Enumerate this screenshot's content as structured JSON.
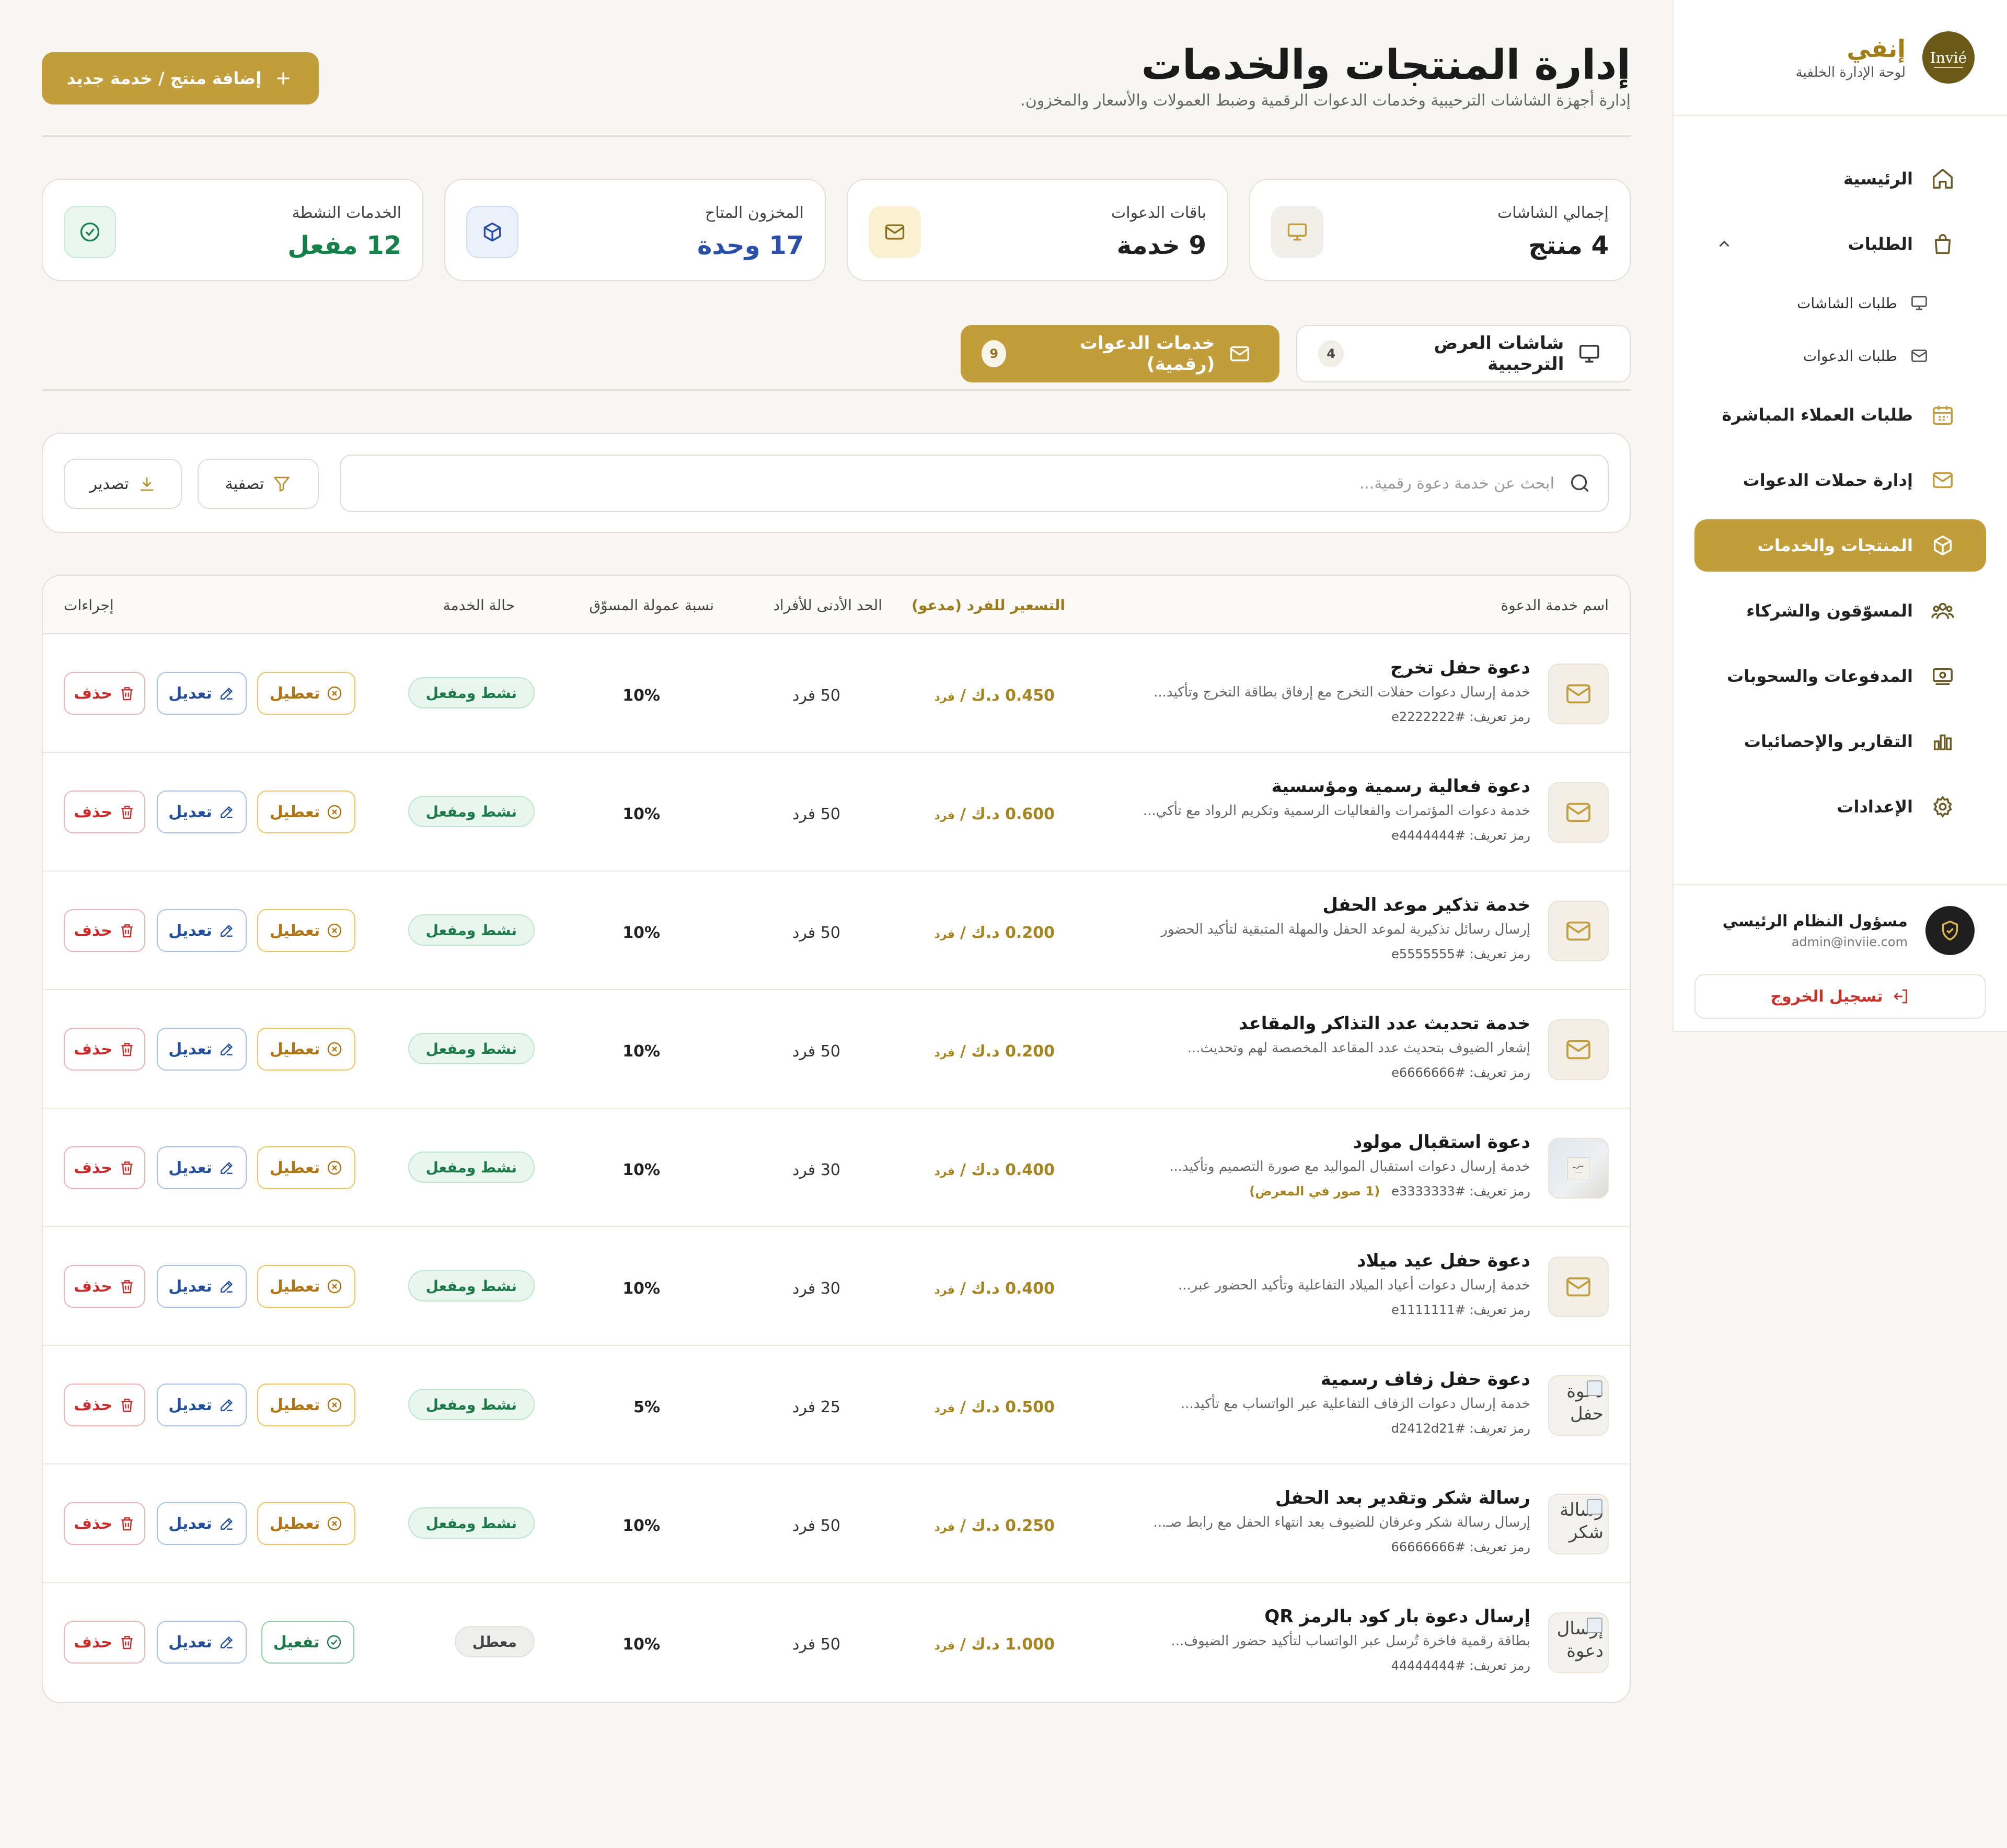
{
  "brand": {
    "logo_text": "Invié",
    "name": "إنفي",
    "subtitle": "لوحة الإدارة الخلفية"
  },
  "nav": {
    "home": "الرئيسية",
    "orders": "الطلبات",
    "screen_orders": "طلبات الشاشات",
    "invite_orders": "طلبات الدعوات",
    "direct_orders": "طلبات العملاء المباشرة",
    "campaigns": "إدارة حملات الدعوات",
    "products": "المنتجات والخدمات",
    "marketers": "المسوّقون والشركاء",
    "payments": "المدفوعات والسحوبات",
    "reports": "التقارير والإحصائيات",
    "settings": "الإعدادات"
  },
  "user": {
    "name": "مسؤول النظام الرئيسي",
    "email": "admin@inviie.com",
    "logout": "تسجيل الخروج"
  },
  "header": {
    "title": "إدارة المنتجات والخدمات",
    "subtitle": "إدارة أجهزة الشاشات الترحيبية وخدمات الدعوات الرقمية وضبط العمولات والأسعار والمخزون.",
    "add_button": "إضافة منتج / خدمة جديد"
  },
  "stats": [
    {
      "label": "إجمالي الشاشات",
      "value": "4 منتج",
      "color": "#1f1f1f"
    },
    {
      "label": "باقات الدعوات",
      "value": "9 خدمة",
      "color": "#1f1f1f"
    },
    {
      "label": "المخزون المتاح",
      "value": "17 وحدة",
      "color": "#2b4fa8"
    },
    {
      "label": "الخدمات النشطة",
      "value": "12 مفعل",
      "color": "#16804a"
    }
  ],
  "tabs": {
    "screens": {
      "label": "شاشات العرض الترحيبية",
      "count": "4"
    },
    "invitations": {
      "label": "خدمات الدعوات (رقمية)",
      "count": "9"
    }
  },
  "filters": {
    "search_placeholder": "ابحث عن خدمة دعوة رقمية...",
    "filter": "تصفية",
    "export": "تصدير"
  },
  "table": {
    "headers": {
      "name": "اسم خدمة الدعوة",
      "price": "التسعير للفرد (مدعو)",
      "min": "الحد الأدنى للأفراد",
      "commission": "نسبة عمولة المسوّق",
      "status": "حالة الخدمة",
      "actions": "إجراءات"
    },
    "code_prefix": "رمز تعريف:",
    "currency_unit": "د.ك /",
    "per_person": "فرد",
    "edit_label": "تعديل",
    "delete_label": "حذف",
    "rows": [
      {
        "thumb": "mail",
        "name": "دعوة حفل تخرج",
        "desc": "خدمة إرسال دعوات حفلات التخرج مع إرفاق بطاقة التخرج وتأكيد...",
        "code": "#e2222222",
        "gallery": "",
        "price": "0.450",
        "min": "50 فرد",
        "commission": "10%",
        "status": "نشط ومفعل",
        "active": true,
        "toggle": "تعطيل"
      },
      {
        "thumb": "mail",
        "name": "دعوة فعالية رسمية ومؤسسية",
        "desc": "خدمة دعوات المؤتمرات والفعاليات الرسمية وتكريم الرواد مع تأكي...",
        "code": "#e4444444",
        "gallery": "",
        "price": "0.600",
        "min": "50 فرد",
        "commission": "10%",
        "status": "نشط ومفعل",
        "active": true,
        "toggle": "تعطيل"
      },
      {
        "thumb": "mail",
        "name": "خدمة تذكير موعد الحفل",
        "desc": "إرسال رسائل تذكيرية لموعد الحفل والمهلة المتبقية لتأكيد الحضور",
        "code": "#e5555555",
        "gallery": "",
        "price": "0.200",
        "min": "50 فرد",
        "commission": "10%",
        "status": "نشط ومفعل",
        "active": true,
        "toggle": "تعطيل"
      },
      {
        "thumb": "mail",
        "name": "خدمة تحديث عدد التذاكر والمقاعد",
        "desc": "إشعار الضيوف بتحديث عدد المقاعد المخصصة لهم وتحديث...",
        "code": "#e6666666",
        "gallery": "",
        "price": "0.200",
        "min": "50 فرد",
        "commission": "10%",
        "status": "نشط ومفعل",
        "active": true,
        "toggle": "تعطيل"
      },
      {
        "thumb": "photo",
        "name": "دعوة استقبال مولود",
        "desc": "خدمة إرسال دعوات استقبال المواليد مع صورة التصميم وتأكيد...",
        "code": "#e3333333",
        "gallery": "(1 صور في المعرض)",
        "price": "0.400",
        "min": "30 فرد",
        "commission": "10%",
        "status": "نشط ومفعل",
        "active": true,
        "toggle": "تعطيل"
      },
      {
        "thumb": "mail",
        "name": "دعوة حفل عيد ميلاد",
        "desc": "خدمة إرسال دعوات أعياد الميلاد التفاعلية وتأكيد الحضور عبر...",
        "code": "#e1111111",
        "gallery": "",
        "price": "0.400",
        "min": "30 فرد",
        "commission": "10%",
        "status": "نشط ومفعل",
        "active": true,
        "toggle": "تعطيل"
      },
      {
        "thumb": "broken",
        "alt": "دعوة حفل",
        "name": "دعوة حفل زفاف رسمية",
        "desc": "خدمة إرسال دعوات الزفاف التفاعلية عبر الواتساب مع تأكيد...",
        "code": "#d2412d21",
        "gallery": "",
        "price": "0.500",
        "min": "25 فرد",
        "commission": "5%",
        "status": "نشط ومفعل",
        "active": true,
        "toggle": "تعطيل"
      },
      {
        "thumb": "broken",
        "alt": "رسالة شكر",
        "name": "رسالة شكر وتقدير بعد الحفل",
        "desc": "إرسال رسالة شكر وعرفان للضيوف بعد انتهاء الحفل مع رابط صـ...",
        "code": "#66666666",
        "gallery": "",
        "price": "0.250",
        "min": "50 فرد",
        "commission": "10%",
        "status": "نشط ومفعل",
        "active": true,
        "toggle": "تعطيل"
      },
      {
        "thumb": "broken",
        "alt": "إرسال دعوة",
        "name": "إرسال دعوة بار كود بالرمز QR",
        "desc": "بطاقة رقمية فاخرة تُرسل عبر الواتساب لتأكيد حضور الضيوف...",
        "code": "#44444444",
        "gallery": "",
        "price": "1.000",
        "min": "50 فرد",
        "commission": "10%",
        "status": "معطل",
        "active": false,
        "toggle": "تفعيل"
      }
    ]
  }
}
